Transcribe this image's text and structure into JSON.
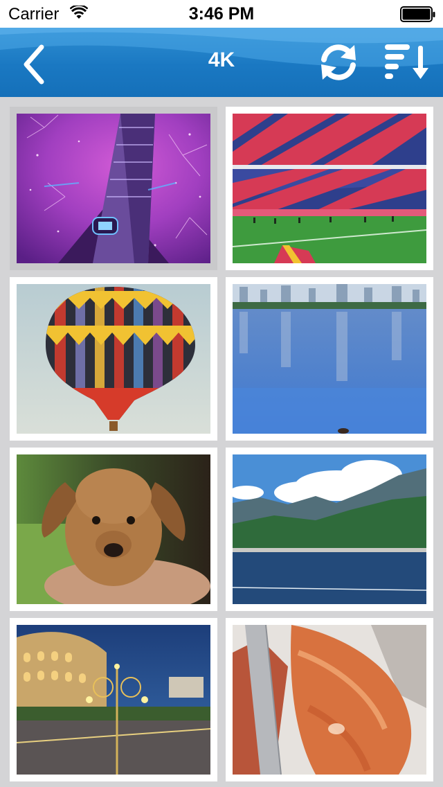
{
  "status_bar": {
    "carrier": "Carrier",
    "time": "3:46 PM"
  },
  "nav": {
    "title": "4K",
    "back_icon": "chevron-left-icon",
    "refresh_icon": "refresh-icon",
    "sort_icon": "sort-descending-icon"
  },
  "colors": {
    "nav_bar": "#1a78c2",
    "grid_background": "#d4d4d6",
    "selected_tile": "#c9c9cb"
  },
  "thumbnails": [
    {
      "name": "fireworks-tower-thumbnail",
      "selected": true
    },
    {
      "name": "stadium-crowd-thumbnail",
      "selected": false
    },
    {
      "name": "hot-air-balloon-thumbnail",
      "selected": false
    },
    {
      "name": "city-lake-reflection-thumbnail",
      "selected": false
    },
    {
      "name": "puppy-thumbnail",
      "selected": false
    },
    {
      "name": "mountain-lake-thumbnail",
      "selected": false
    },
    {
      "name": "colosseum-night-thumbnail",
      "selected": false
    },
    {
      "name": "sliced-meat-thumbnail",
      "selected": false
    }
  ]
}
